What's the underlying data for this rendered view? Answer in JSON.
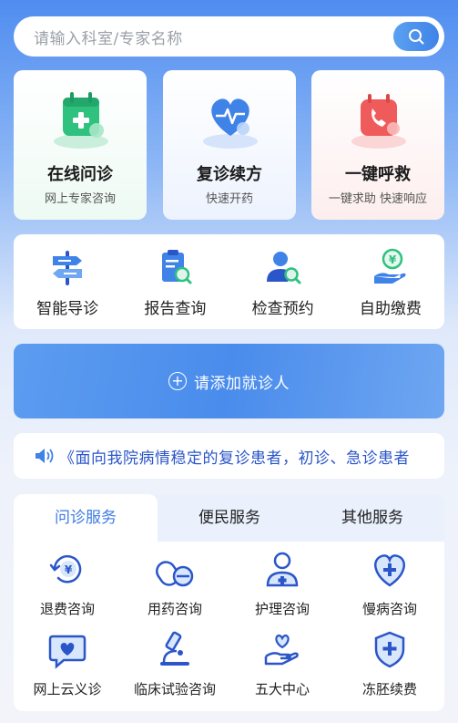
{
  "search": {
    "placeholder": "请输入科室/专家名称"
  },
  "top_cards": [
    {
      "title": "在线问诊",
      "subtitle": "网上专家咨询",
      "icon": "medical-calendar-icon",
      "accent": "#2ec27e"
    },
    {
      "title": "复诊续方",
      "subtitle": "快速开药",
      "icon": "heart-pulse-icon",
      "accent": "#3f83e8"
    },
    {
      "title": "一键呼救",
      "subtitle": "一键求助 快速响应",
      "icon": "emergency-phone-icon",
      "accent": "#ef5b5b"
    }
  ],
  "quick_actions": [
    {
      "label": "智能导诊",
      "icon": "signpost-icon"
    },
    {
      "label": "报告查询",
      "icon": "report-search-icon"
    },
    {
      "label": "检查预约",
      "icon": "user-search-icon"
    },
    {
      "label": "自助缴费",
      "icon": "payment-yen-icon"
    }
  ],
  "add_patient": {
    "label": "请添加就诊人"
  },
  "notice": {
    "text": "《面向我院病情稳定的复诊患者，初诊、急诊患者"
  },
  "services": {
    "tabs": [
      "问诊服务",
      "便民服务",
      "其他服务"
    ],
    "active_tab": "问诊服务",
    "items": [
      {
        "label": "退费咨询",
        "icon": "refund-yen-icon"
      },
      {
        "label": "用药咨询",
        "icon": "pill-icon"
      },
      {
        "label": "护理咨询",
        "icon": "nurse-icon"
      },
      {
        "label": "慢病咨询",
        "icon": "heart-plus-icon"
      },
      {
        "label": "网上云义诊",
        "icon": "chat-heart-icon"
      },
      {
        "label": "临床试验咨询",
        "icon": "microscope-icon"
      },
      {
        "label": "五大中心",
        "icon": "hand-heart-icon"
      },
      {
        "label": "冻胚续费",
        "icon": "shield-plus-icon"
      }
    ]
  },
  "colors": {
    "primary": "#3f83e8",
    "notice_text": "#2b56c9",
    "tab_active": "#3d7be0"
  }
}
